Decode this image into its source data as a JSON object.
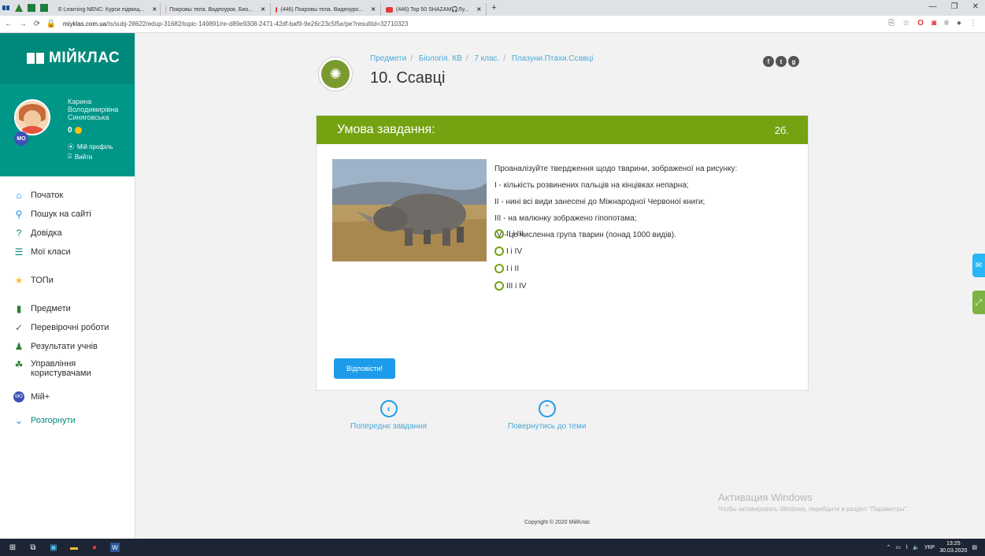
{
  "browser": {
    "tabs": [
      {
        "label": "E-Learning NENC: Курси підвищ...",
        "active": false
      },
      {
        "label": "Покровы тела. Видеоурок. Био...",
        "active": false
      },
      {
        "label": "(446) Покровы тела. Видеоуро...",
        "active": false
      },
      {
        "label": "(446) Top 50 SHAZAM🎧Лу...",
        "active": false
      }
    ],
    "new_tab": "+",
    "url_host": "miyklas.com.ua",
    "url_path": "/ts/subj-28622/edup-31682/topic-149891/re-d89e9308-2471-42df-baf9-9e26c23c5f5e/pe?resultId=32710323"
  },
  "sidebar": {
    "brand": "МІЙКЛАС",
    "profile": {
      "name_lines": [
        "Карина",
        "Володимирівна",
        "Синяговська"
      ],
      "badge": "МО",
      "score": "0",
      "profile_link": "Мій профіль",
      "logout_link": "Вийти"
    },
    "menu": [
      {
        "label": "Початок",
        "icon": "home-icon"
      },
      {
        "label": "Пошук на сайті",
        "icon": "search-icon"
      },
      {
        "label": "Довідка",
        "icon": "help-icon"
      },
      {
        "label": "Мої класи",
        "icon": "classes-icon"
      },
      {
        "label": "ТОПи",
        "icon": "star-icon"
      },
      {
        "label": "Предмети",
        "icon": "book-icon"
      },
      {
        "label": "Перевірочні роботи",
        "icon": "check-icon"
      },
      {
        "label": "Результати учнів",
        "icon": "users-icon"
      },
      {
        "label": "Управління користувачами",
        "icon": "user-manage-icon"
      },
      {
        "label": "Мій+",
        "icon": "my-plus-icon"
      },
      {
        "label": "Розгорнути",
        "icon": "chevron-down-icon"
      }
    ]
  },
  "page": {
    "breadcrumbs": [
      "Предмети",
      "Біологія. КВ",
      "7 клас.",
      "Плазуни.Птахи.Ссавці"
    ],
    "title": "10. Ссавці"
  },
  "task": {
    "header": "Умова завдання:",
    "points": "2б.",
    "question_lines": [
      "Проаналізуйте твердження щодо тварини, зображеної на рисунку:",
      "І - кількість розвинених пальців на кінцівках непарна;",
      "ІІ - нині всі види занесені до Міжнародної Червоної книги;",
      "ІІІ - на малюнку зображено гіпопотама;",
      "IV -  це  численна група тварин (понад 1000 видів)."
    ],
    "options": [
      "ІІ і ІІІ",
      "І і IV",
      "І і ІІ",
      "ІІІ і IV"
    ],
    "submit_label": "Відповісти!"
  },
  "navigation": {
    "prev_label": "Попереднє завдання",
    "back_label": "Повернутись до теми"
  },
  "footer": {
    "copyright": "Copyright © 2020 МійКлас",
    "watermark_title": "Активация Windows",
    "watermark_sub": "Чтобы активировать Windows, перейдите в раздел \"Параметры\"."
  },
  "taskbar": {
    "lang": "УКР",
    "time": "13:25",
    "date": "30.03.2020"
  }
}
